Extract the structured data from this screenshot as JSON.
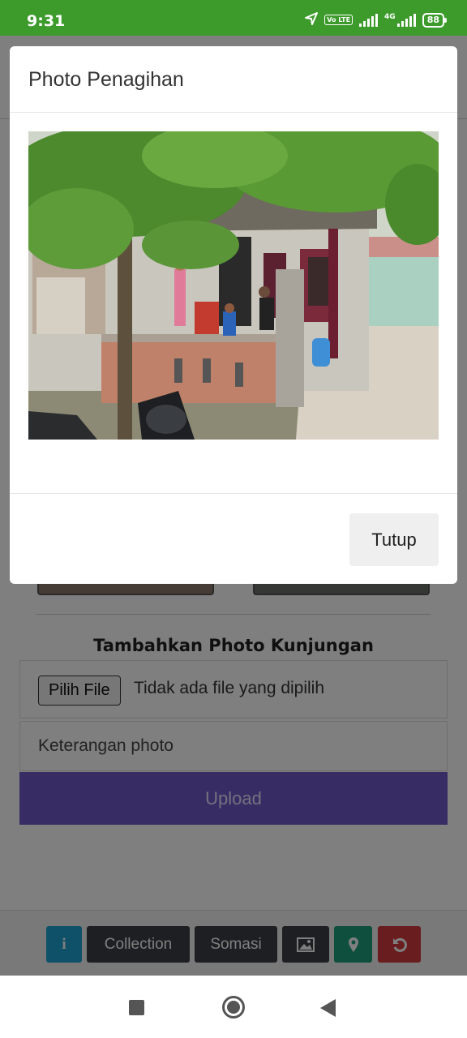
{
  "status_bar": {
    "time": "9:31",
    "battery": "88",
    "network_label": "4G",
    "volte_label": "Vo LTE"
  },
  "modal": {
    "title": "Photo Penagihan",
    "close_button": "Tutup"
  },
  "page": {
    "section_title": "Tambahkan Photo Kunjungan",
    "file_button": "Pilih File",
    "file_status": "Tidak ada file yang dipilih",
    "caption_placeholder": "Keterangan photo",
    "upload_button": "Upload"
  },
  "toolbar": {
    "info_label": "i",
    "collection_label": "Collection",
    "somasi_label": "Somasi",
    "gallery_icon": "image-icon",
    "location_icon": "map-marker-icon",
    "undo_icon": "undo-icon"
  },
  "colors": {
    "status_bar": "#3d9b2c",
    "upload": "#6f58c9",
    "info": "#1fa3d1",
    "dark_button": "#3b3f44",
    "location": "#1f9e7a",
    "undo": "#d33a3f"
  }
}
